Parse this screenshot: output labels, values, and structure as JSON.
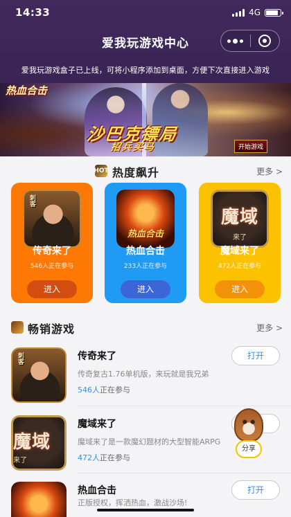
{
  "status_bar": {
    "time": "14:33",
    "network": "4G"
  },
  "header": {
    "title": "爱我玩游戏中心",
    "notice": "爱我玩游戏盒子已上线，可将小程序添加到桌面，方便下次直接进入游戏"
  },
  "banner": {
    "logo": "热血合击",
    "headline": "沙巴克镖局",
    "subline": "招兵买马",
    "button": "开始游戏"
  },
  "hot": {
    "icon_text": "HOT",
    "title": "热度飙升",
    "more": "更多 >",
    "cards": [
      {
        "name": "传奇来了",
        "count": "546人正在参与",
        "enter": "进入",
        "color": "#fe7806"
      },
      {
        "name": "热血合击",
        "count": "233人正在参与",
        "enter": "进入",
        "color": "#1f9bf4"
      },
      {
        "name": "魔域来了",
        "count": "472人正在参与",
        "enter": "进入",
        "color": "#fcc100"
      }
    ]
  },
  "bestseller": {
    "title": "畅销游戏",
    "more": "更多 >",
    "items": [
      {
        "name": "传奇来了",
        "desc": "传奇复古1.76单机版，来玩就是我兄弟",
        "players_num": "546人",
        "players_suffix": "正在参与",
        "open": "打开"
      },
      {
        "name": "魔域来了",
        "desc": "魔域来了是一款魔幻题材的大型智能ARPG",
        "players_num": "472人",
        "players_suffix": "正在参与",
        "open": "打开"
      },
      {
        "name": "热血合击",
        "desc": "正版授权，挥洒热血，激战沙场!",
        "players_num": "",
        "players_suffix": "",
        "open": "打开"
      }
    ]
  },
  "art": {
    "chuanqi_tag": "刺客",
    "rexue_tag": "热血合击",
    "moyu_tag": "魔域",
    "moyu_sub": "来了"
  },
  "share": {
    "label": "分享"
  },
  "colors": {
    "header_bg": "#41295c",
    "accent_blue": "#2c92f0",
    "card_orange": "#fe7806",
    "card_blue": "#1f9bf4",
    "card_yellow": "#fcc100"
  }
}
